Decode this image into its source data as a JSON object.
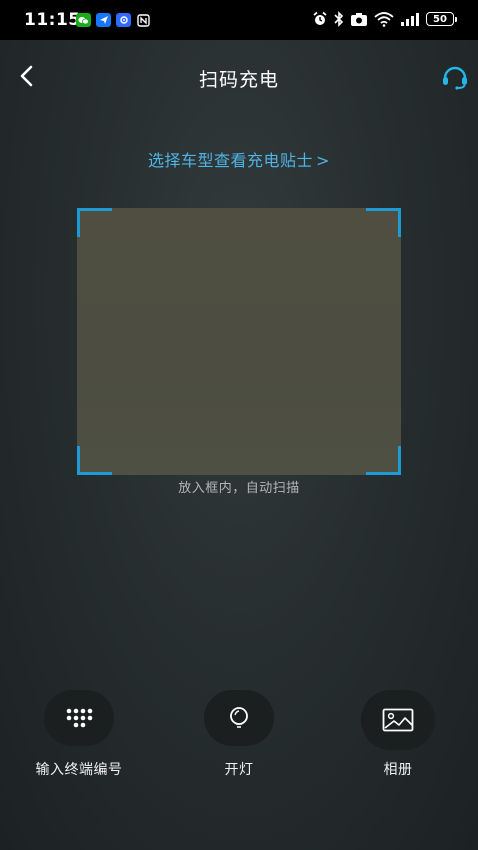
{
  "status_bar": {
    "time": "11:15",
    "battery": "50"
  },
  "header": {
    "title": "扫码充电"
  },
  "tips": {
    "text": "选择车型查看充电贴士",
    "arrow": ">"
  },
  "scanner": {
    "hint": "放入框内，自动扫描"
  },
  "actions": [
    {
      "label": "输入终端编号",
      "icon": "keypad-icon"
    },
    {
      "label": "开灯",
      "icon": "flashlight-icon"
    },
    {
      "label": "相册",
      "icon": "photo-album-icon"
    }
  ],
  "colors": {
    "accent": "#1e9ad6",
    "link": "#4fb3e6",
    "background": "#272e30"
  }
}
